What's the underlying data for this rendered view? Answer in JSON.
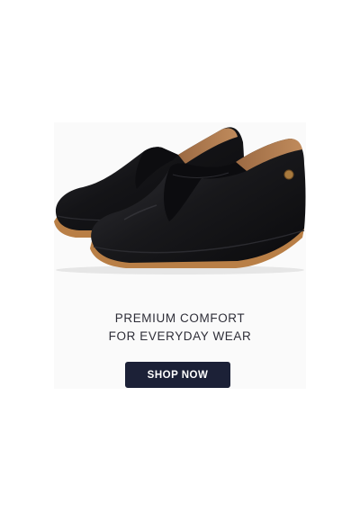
{
  "hero": {
    "image": "black-slip-on-leather-shoes",
    "headline_line1": "PREMIUM COMFORT",
    "headline_line2": "FOR EVERYDAY WEAR"
  },
  "cta": {
    "label": "SHOP NOW"
  },
  "colors": {
    "page_background": "#ffffff",
    "card_background": "#fafafa",
    "button_background": "#1c2137",
    "button_text": "#ffffff",
    "headline_text": "#2e2e38",
    "shoe_leather": "#111114",
    "shoe_sole": "#b97f46",
    "shoe_lining": "#b98357"
  }
}
